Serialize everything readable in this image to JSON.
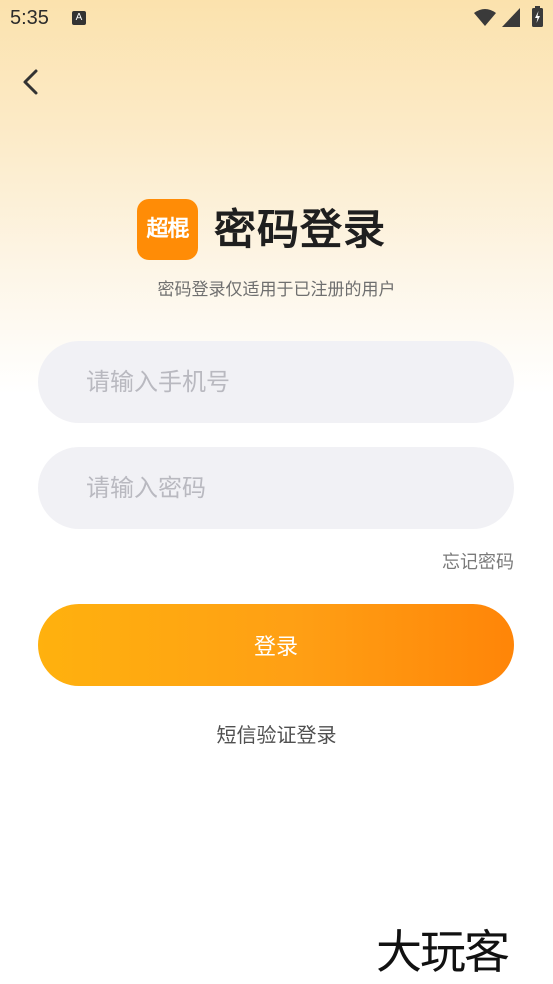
{
  "status_bar": {
    "time": "5:35",
    "notification_icon": "A"
  },
  "header": {
    "logo_text": "超棍",
    "title": "密码登录",
    "subtitle": "密码登录仅适用于已注册的用户"
  },
  "form": {
    "phone_placeholder": "请输入手机号",
    "phone_value": "",
    "password_placeholder": "请输入密码",
    "password_value": "",
    "forgot_label": "忘记密码",
    "login_label": "登录",
    "sms_login_label": "短信验证登录"
  },
  "watermark": "大玩客",
  "colors": {
    "accent_start": "#ffb10e",
    "accent_end": "#ff8508",
    "logo_bg": "#ff8c06",
    "input_bg": "#f1f1f5"
  },
  "icons": [
    "wifi-icon",
    "signal-icon",
    "battery-icon",
    "back-arrow-icon"
  ]
}
